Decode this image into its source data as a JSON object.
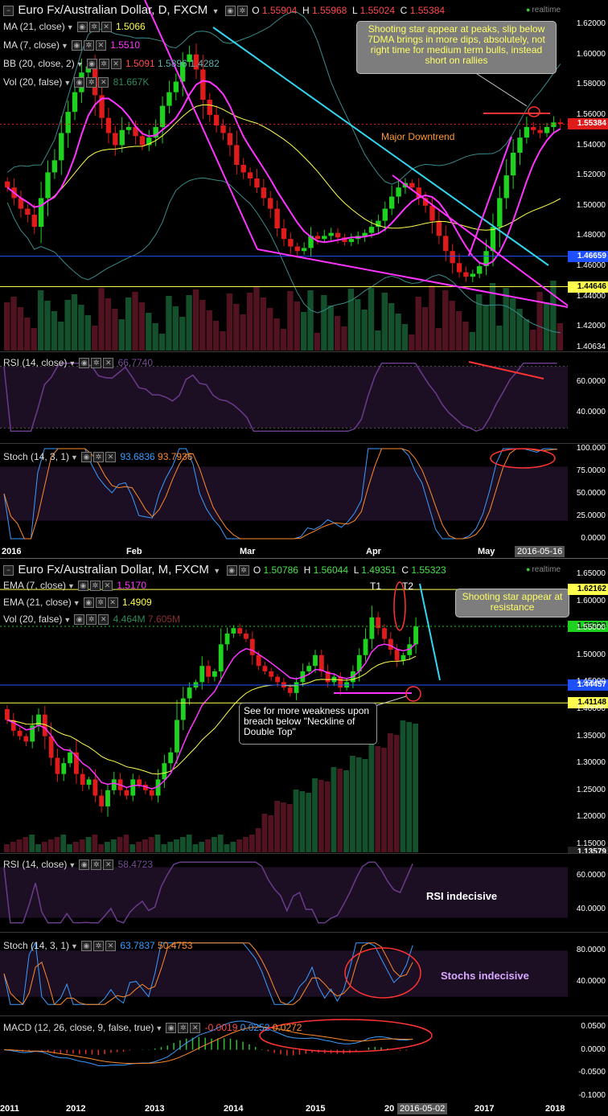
{
  "colors": {
    "up": "#1fd21f",
    "down": "#e01b1b",
    "ma21": "#ffff4d",
    "ma7": "#ff33ff",
    "bb": "#3a8a8a",
    "cyan": "#33d6f0",
    "magenta": "#ff33ff",
    "red": "#ff3333",
    "rsi": "#6a3b8a",
    "stochK": "#3a9cff",
    "stochD": "#ff8a2a",
    "bg": "#000000"
  },
  "realtime_label": "realtime",
  "top_chart": {
    "title": "Euro Fx/Australian Dollar, D, FXCM",
    "ohlc": {
      "o_label": "O",
      "o": "1.55904",
      "h_label": "H",
      "h": "1.55968",
      "l_label": "L",
      "l": "1.55024",
      "c_label": "C",
      "c": "1.55384"
    },
    "studies": [
      {
        "label": "MA (21, close)",
        "values": [
          "1.5066"
        ],
        "color": "#ffff4d"
      },
      {
        "label": "MA (7, close)",
        "values": [
          "1.5510"
        ],
        "color": "#ff33ff"
      },
      {
        "label": "BB (20, close, 2)",
        "values": [
          "1.5091",
          "1.5896",
          "1.4282"
        ],
        "color": "#3a8a8a"
      },
      {
        "label": "Vol (20, false)",
        "values": [
          "81.667K"
        ],
        "color": "#2e8b57"
      }
    ],
    "price_ticks": [
      "1.62000",
      "1.60000",
      "1.58000",
      "1.56000",
      "1.54000",
      "1.52000",
      "1.50000",
      "1.48000",
      "1.46000",
      "1.44000",
      "1.42000",
      "1.40634"
    ],
    "price_tags": [
      {
        "value": "1.55384",
        "color": "#e01b1b"
      },
      {
        "value": "1.46659",
        "color": "#1e50ff"
      },
      {
        "value": "1.44646",
        "color": "#ffff4d"
      }
    ],
    "annotation_note": "Shooting star appear at peaks, slip below 7DMA brings in more dips, absolutely, not right time for medium term bulls, instead short on rallies",
    "trend_label": "Major Downtrend",
    "rsi": {
      "label": "RSI (14, close)",
      "value": "66.7740",
      "ticks": [
        "60.0000",
        "40.0000"
      ]
    },
    "stoch": {
      "label": "Stoch (14, 3, 1)",
      "k": "93.6836",
      "d": "93.7936",
      "ticks": [
        "100.000",
        "75.0000",
        "50.0000",
        "25.0000",
        "0.0000"
      ]
    },
    "x_labels": [
      "2016",
      "Feb",
      "Mar",
      "Apr",
      "May"
    ],
    "x_cursor": "2016-05-16"
  },
  "bottom_chart": {
    "title": "Euro Fx/Australian Dollar, M, FXCM",
    "ohlc": {
      "o_label": "O",
      "o": "1.50786",
      "h_label": "H",
      "h": "1.56044",
      "l_label": "L",
      "l": "1.49351",
      "c_label": "C",
      "c": "1.55323"
    },
    "studies": [
      {
        "label": "EMA (7, close)",
        "values": [
          "1.5170"
        ],
        "color": "#ff33ff"
      },
      {
        "label": "EMA (21, close)",
        "values": [
          "1.4909"
        ],
        "color": "#ffff4d"
      },
      {
        "label": "Vol (20, false)",
        "values": [
          "4.464M",
          "7.605M"
        ],
        "color": "#2e8b57"
      }
    ],
    "price_ticks": [
      "1.65000",
      "1.60000",
      "1.55000",
      "1.50000",
      "1.45000",
      "1.40000",
      "1.35000",
      "1.30000",
      "1.25000",
      "1.20000",
      "1.15000"
    ],
    "price_tags": [
      {
        "value": "1.62162",
        "color": "#ffff4d"
      },
      {
        "value": "1.55323",
        "color": "#1fd21f"
      },
      {
        "value": "1.44457",
        "color": "#1e50ff"
      },
      {
        "value": "1.41148",
        "color": "#ffff4d"
      },
      {
        "value": "1.13579",
        "color": "#222222"
      }
    ],
    "t1": "T1",
    "t2": "T2",
    "note_resistance": "Shooting star appear at resistance",
    "note_neckline": "See for more weakness upon breach below \"Neckline of Double Top\"",
    "rsi": {
      "label": "RSI (14, close)",
      "value": "58.4723",
      "ticks": [
        "60.0000",
        "40.0000"
      ],
      "comment": "RSI indecisive"
    },
    "stoch": {
      "label": "Stoch (14, 3, 1)",
      "k": "63.7837",
      "d": "50.4753",
      "ticks": [
        "80.0000",
        "40.0000"
      ],
      "comment": "Stochs indecisive"
    },
    "macd": {
      "label": "MACD (12, 26, close, 9, false, true)",
      "values": [
        "-0.0019",
        "0.0252",
        "0.0272"
      ],
      "ticks": [
        "0.0500",
        "0.0000",
        "-0.0500",
        "-0.1000"
      ]
    },
    "x_labels": [
      "2011",
      "2012",
      "2013",
      "2014",
      "2015",
      "20",
      "2017",
      "2018"
    ],
    "x_cursor": "2016-05-02"
  },
  "chart_data": [
    {
      "type": "candlestick",
      "title": "Euro Fx/Australian Dollar, D, FXCM",
      "period": "Daily, Jan–May 2016",
      "close_series_approx": [
        1.512,
        1.505,
        1.498,
        1.494,
        1.486,
        1.505,
        1.522,
        1.53,
        1.548,
        1.562,
        1.575,
        1.588,
        1.592,
        1.573,
        1.558,
        1.548,
        1.54,
        1.55,
        1.552,
        1.546,
        1.54,
        1.545,
        1.552,
        1.566,
        1.575,
        1.582,
        1.595,
        1.6,
        1.59,
        1.57,
        1.56,
        1.553,
        1.548,
        1.54,
        1.527,
        1.522,
        1.518,
        1.512,
        1.505,
        1.498,
        1.485,
        1.478,
        1.473,
        1.47,
        1.472,
        1.48,
        1.478,
        1.48,
        1.482,
        1.479,
        1.476,
        1.478,
        1.48,
        1.482,
        1.486,
        1.49,
        1.498,
        1.506,
        1.512,
        1.515,
        1.512,
        1.505,
        1.5,
        1.49,
        1.48,
        1.47,
        1.462,
        1.456,
        1.453,
        1.455,
        1.46,
        1.47,
        1.486,
        1.505,
        1.52,
        1.535,
        1.545,
        1.552,
        1.55,
        1.548,
        1.552,
        1.555,
        1.554
      ],
      "ylim": [
        1.40634,
        1.62
      ]
    },
    {
      "type": "candlestick",
      "title": "Euro Fx/Australian Dollar, M, FXCM",
      "period": "Monthly, 2011–2016",
      "close_series_approx": [
        1.38,
        1.36,
        1.35,
        1.34,
        1.37,
        1.39,
        1.35,
        1.31,
        1.28,
        1.3,
        1.32,
        1.28,
        1.26,
        1.27,
        1.24,
        1.22,
        1.25,
        1.27,
        1.25,
        1.24,
        1.27,
        1.26,
        1.25,
        1.24,
        1.27,
        1.3,
        1.32,
        1.38,
        1.42,
        1.44,
        1.45,
        1.48,
        1.46,
        1.47,
        1.52,
        1.54,
        1.55,
        1.54,
        1.53,
        1.5,
        1.48,
        1.47,
        1.46,
        1.45,
        1.44,
        1.43,
        1.45,
        1.47,
        1.48,
        1.5,
        1.47,
        1.45,
        1.46,
        1.44,
        1.45,
        1.47,
        1.5,
        1.53,
        1.57,
        1.55,
        1.53,
        1.51,
        1.49,
        1.5,
        1.52,
        1.553
      ],
      "ylim": [
        1.15,
        1.65
      ]
    }
  ]
}
